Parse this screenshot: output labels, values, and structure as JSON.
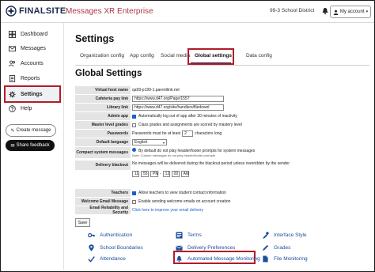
{
  "header": {
    "logo_text": "FINALSITE",
    "product": "Messages XR Enterprise",
    "district": "99-3 School District",
    "account_label": "My account"
  },
  "sidebar": {
    "items": [
      {
        "label": "Dashboard",
        "icon": "dashboard-icon"
      },
      {
        "label": "Messages",
        "icon": "envelope-icon"
      },
      {
        "label": "Accounts",
        "icon": "users-icon"
      },
      {
        "label": "Reports",
        "icon": "reports-icon"
      },
      {
        "label": "Settings",
        "icon": "gear-icon"
      },
      {
        "label": "Help",
        "icon": "help-icon"
      }
    ],
    "create_message": "Create message",
    "share_feedback": "Share feedback"
  },
  "main": {
    "title": "Settings",
    "tabs": [
      "Organization config",
      "App config",
      "Social media",
      "Global settings",
      "Data config"
    ],
    "active_tab": "Global settings",
    "section_title": "Global Settings",
    "form": {
      "virtual_host": {
        "label": "Virtual host name",
        "value": "qa99-p199-1.parentlink.net"
      },
      "cafeteria": {
        "label": "Cafeteria pay link",
        "value": "https://www.d47.org/Page/1557"
      },
      "library": {
        "label": "Library link",
        "value": "https://www.d47.org/site/handlers/filedownl"
      },
      "admin_app": {
        "label": "Admin app",
        "text": "Automatically log out of app after 30 minutes of inactivity"
      },
      "master_grades": {
        "label": "Master level grades",
        "text": "Class grades and assignments are scored by mastery level"
      },
      "passwords": {
        "label": "Passwords",
        "prefix": "Passwords must be at least",
        "value": "2",
        "suffix": "characters long"
      },
      "language": {
        "label": "Default language",
        "value": "English"
      },
      "compact": {
        "label": "Compact system messages",
        "text": "By default do not play header/footer prompts for system messages",
        "note": "Note: Custom messages do not play header/footer prompts"
      },
      "blackout": {
        "label": "Delivery blackout",
        "text": "No messages will be delivered during the blackout period unless overridden by the sender",
        "start_h": "11",
        "start_m": "55",
        "start_ap": "PM",
        "dash": "-",
        "end_h": "12",
        "end_m": "00",
        "end_ap": "AM"
      },
      "teachers": {
        "label": "Teachers",
        "text": "Allow teachers to view student contact information"
      },
      "welcome": {
        "label": "Welcome Email Message",
        "text": "Enable sending welcome emails on account creation"
      },
      "reliability": {
        "label": "Email Reliability and Security",
        "link": "Click here to improve your email delivery"
      },
      "save": "Save"
    },
    "shortcuts": [
      {
        "label": "Authentication",
        "icon": "key-icon"
      },
      {
        "label": "Terms",
        "icon": "terms-icon"
      },
      {
        "label": "Interface Style",
        "icon": "palette-icon"
      },
      {
        "label": "School Boundaries",
        "icon": "map-pin-icon"
      },
      {
        "label": "Delivery Preferences",
        "icon": "envelope-icon"
      },
      {
        "label": "Grades",
        "icon": "grades-icon"
      },
      {
        "label": "Attendance",
        "icon": "attendance-icon"
      },
      {
        "label": "Automated Message Monitoring",
        "icon": "bell-icon"
      },
      {
        "label": "File Monitoring",
        "icon": "file-icon"
      }
    ]
  },
  "colors": {
    "accent": "#1a4fa0",
    "highlight": "#b31b2a",
    "brand": "#b03848"
  }
}
